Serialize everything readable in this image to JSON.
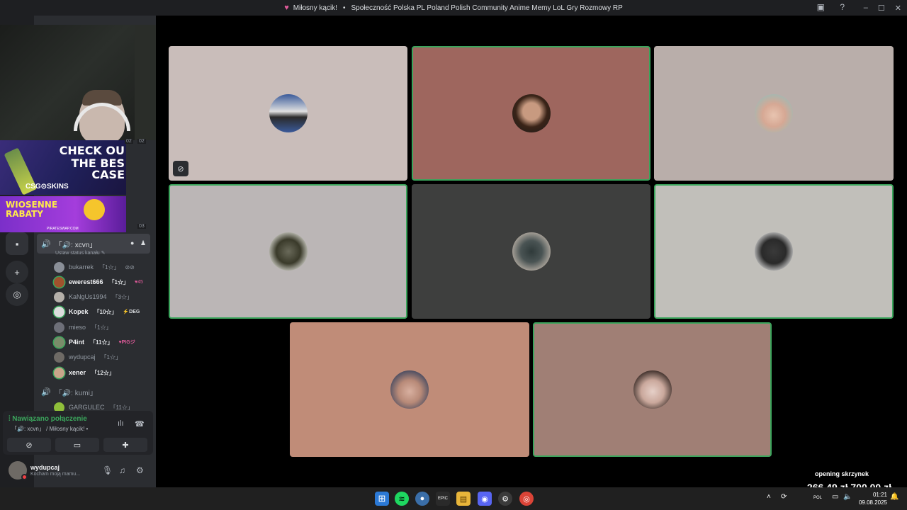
{
  "titlebar": {
    "server_name": "Miłosny kącik!",
    "separator": "•",
    "community": "Społeczność Polska PL Poland Polish Community Anime Memy LoL Gry Rozmowy RP",
    "heart_icon": "heart-icon",
    "window_controls": {
      "minimize": "–",
      "maximize": "☐",
      "close": "✕"
    }
  },
  "overlay": {
    "ad1_line1": "CHECK OU",
    "ad1_line2": "THE BES",
    "ad1_line3": "CASE",
    "ad1_brand": "CSG⊙SKINS",
    "ad2_line1": "WIOSENNE",
    "ad2_line2": "RABATY",
    "ad2_small": "PIRATESWAP.COM",
    "num_top": "02",
    "num_top2": "02",
    "num_bottom": "03"
  },
  "channels": {
    "voice1": {
      "name": "「🔊: xcvn」",
      "status": "Ustaw status kanału"
    },
    "members": [
      {
        "name": "bukarrek",
        "level": "「1☆」",
        "bright": false,
        "tag": ""
      },
      {
        "name": "ewerest666",
        "level": "「1☆」",
        "bright": true,
        "tag": "♥45"
      },
      {
        "name": "KaNgUs1994",
        "level": "「3☆」",
        "bright": false,
        "tag": ""
      },
      {
        "name": "Kopek",
        "level": "「10☆」",
        "bright": true,
        "tag": "⚡DEG"
      },
      {
        "name": "mieso",
        "level": "「1☆」",
        "bright": false,
        "tag": ""
      },
      {
        "name": "P4int",
        "level": "「11☆」",
        "bright": true,
        "tag": "♥PIGジ"
      },
      {
        "name": "wydupcaj",
        "level": "「1☆」",
        "bright": false,
        "tag": ""
      },
      {
        "name": "xener",
        "level": "「12☆」",
        "bright": true,
        "tag": ""
      }
    ],
    "voice2": {
      "name": "「🔊: kumi」"
    },
    "voice2_member": {
      "name": "GARGULEC",
      "level": "「11☆」"
    }
  },
  "connection": {
    "status": "Nawiązano połączenie",
    "channel": "「🔊: xcvn」 / Miłosny kącik!",
    "more": "•"
  },
  "user": {
    "name": "wydupcaj",
    "status": "Kocham moją mamu..."
  },
  "tiles": [
    {
      "bg": "#c9bdba",
      "speaking": false,
      "muted": true
    },
    {
      "bg": "#9e665e",
      "speaking": true,
      "muted": false
    },
    {
      "bg": "#b9aeaa",
      "speaking": false,
      "muted": false
    },
    {
      "bg": "#bbb6b6",
      "speaking": true,
      "muted": false
    },
    {
      "bg": "#3e3f3e",
      "speaking": false,
      "muted": false
    },
    {
      "bg": "#c1bfba",
      "speaking": true,
      "muted": false
    },
    {
      "bg": "#c08c78",
      "speaking": false,
      "muted": false
    },
    {
      "bg": "#a07f75",
      "speaking": true,
      "muted": false
    }
  ],
  "goal": {
    "label": "opening skrzynek",
    "amount": "266,49 zł   700,00 zł"
  },
  "taskbar": {
    "time": "01:21",
    "date": "09.08.2025",
    "lang": "POL"
  },
  "colors": {
    "speaking": "#3ba55c",
    "dnd": "#f23f43",
    "bg": "#000000"
  }
}
